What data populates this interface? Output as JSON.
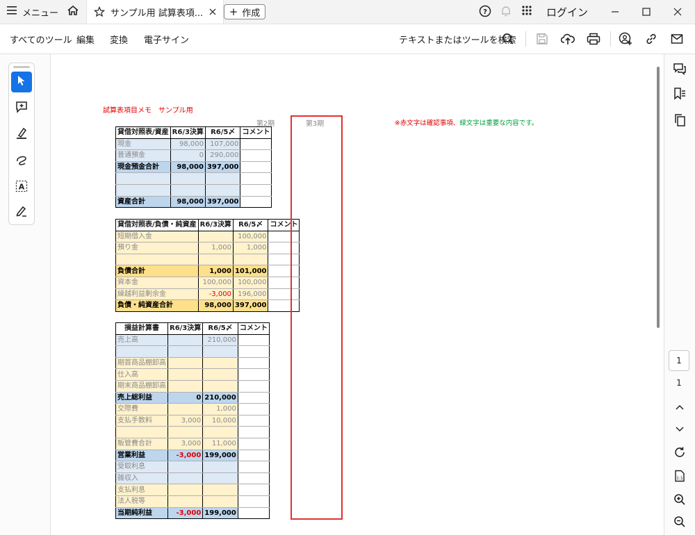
{
  "titlebar": {
    "menu_label": "メニュー",
    "tab_title": "サンプル用 試算表項...",
    "new_label": "作成",
    "login_label": "ログイン"
  },
  "menubar": {
    "items": [
      "すべてのツール",
      "編集",
      "変換",
      "電子サイン"
    ],
    "search_label": "テキストまたはツールを検索"
  },
  "page_nav": {
    "current": "1",
    "total": "1"
  },
  "sheet": {
    "title": "試算表項目メモ　サンプル用",
    "period2": "第2期",
    "period3": "第3期",
    "note_red": "※赤文字は確認事項、",
    "note_green": "緑文字は重要な内容です。",
    "tables": [
      {
        "header": [
          "貸借対照表/資産",
          "R6/3決算",
          "R6/5〆",
          "コメント"
        ],
        "rows": [
          {
            "label": "現金",
            "v1": "98,000",
            "v2": "107,000",
            "style": "blue"
          },
          {
            "label": "普通預金",
            "v1": "0",
            "v2": "290,000",
            "style": "blue"
          },
          {
            "label": "現金預金合計",
            "v1": "98,000",
            "v2": "397,000",
            "style": "blue-b"
          },
          {
            "label": "",
            "v1": "",
            "v2": "",
            "style": "blue"
          },
          {
            "label": "",
            "v1": "",
            "v2": "",
            "style": "blue"
          },
          {
            "label": "資産合計",
            "v1": "98,000",
            "v2": "397,000",
            "style": "blue-b"
          }
        ]
      },
      {
        "header": [
          "貸借対照表/負債・純資産",
          "R6/3決算",
          "R6/5〆",
          "コメント"
        ],
        "rows": [
          {
            "label": "短期借入金",
            "v1": "",
            "v2": "100,000",
            "style": "yel"
          },
          {
            "label": "預り金",
            "v1": "1,000",
            "v2": "1,000",
            "style": "yel"
          },
          {
            "label": "",
            "v1": "",
            "v2": "",
            "style": "yel"
          },
          {
            "label": "負債合計",
            "v1": "1,000",
            "v2": "101,000",
            "style": "yel-b"
          },
          {
            "label": "資本金",
            "v1": "100,000",
            "v2": "100,000",
            "style": "yel"
          },
          {
            "label": "繰越利益剰余金",
            "v1": "-3,000",
            "v2": "196,000",
            "style": "yel",
            "v1_red": true
          },
          {
            "label": "負債・純資産合計",
            "v1": "98,000",
            "v2": "397,000",
            "style": "yel-b"
          }
        ]
      },
      {
        "header": [
          "損益計算書",
          "R6/3決算",
          "R6/5〆",
          "コメント"
        ],
        "rows": [
          {
            "label": "売上高",
            "v1": "",
            "v2": "210,000",
            "style": "blue"
          },
          {
            "label": "",
            "v1": "",
            "v2": "",
            "style": "blue"
          },
          {
            "label": "期首商品棚卸高",
            "v1": "",
            "v2": "",
            "style": "yel"
          },
          {
            "label": "仕入高",
            "v1": "",
            "v2": "",
            "style": "yel"
          },
          {
            "label": "期末商品棚卸高",
            "v1": "",
            "v2": "",
            "style": "yel"
          },
          {
            "label": "売上総利益",
            "v1": "0",
            "v2": "210,000",
            "style": "blue-b"
          },
          {
            "label": "交際費",
            "v1": "",
            "v2": "1,000",
            "style": "yel"
          },
          {
            "label": "支払手数料",
            "v1": "3,000",
            "v2": "10,000",
            "style": "yel"
          },
          {
            "label": "",
            "v1": "",
            "v2": "",
            "style": "yel"
          },
          {
            "label": "販管費合計",
            "v1": "3,000",
            "v2": "11,000",
            "style": "yel-b-light"
          },
          {
            "label": "営業利益",
            "v1": "-3,000",
            "v2": "199,000",
            "style": "blue-b",
            "v1_red": true
          },
          {
            "label": "受取利息",
            "v1": "",
            "v2": "",
            "style": "blue"
          },
          {
            "label": "雑収入",
            "v1": "",
            "v2": "",
            "style": "blue"
          },
          {
            "label": "支払利息",
            "v1": "",
            "v2": "",
            "style": "yel"
          },
          {
            "label": "法人税等",
            "v1": "",
            "v2": "",
            "style": "yel"
          },
          {
            "label": "当期純利益",
            "v1": "-3,000",
            "v2": "199,000",
            "style": "blue-b",
            "v1_red": true
          }
        ]
      }
    ]
  }
}
